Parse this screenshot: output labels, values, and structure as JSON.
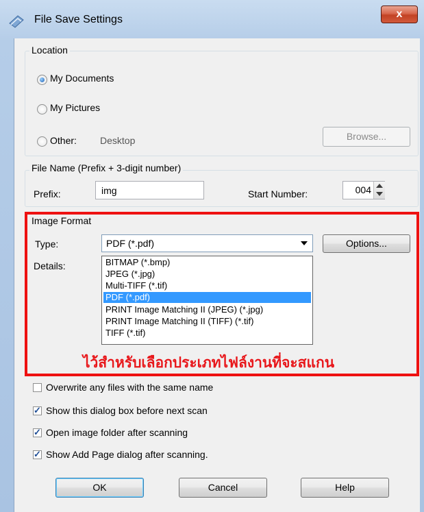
{
  "window": {
    "title": "File Save Settings",
    "close_label": "x"
  },
  "location": {
    "legend": "Location",
    "options": [
      {
        "label": "My Documents",
        "selected": true
      },
      {
        "label": "My Pictures",
        "selected": false
      },
      {
        "label": "Other:",
        "selected": false
      }
    ],
    "other_value": "Desktop",
    "browse_label": "Browse..."
  },
  "filename": {
    "legend": "File Name (Prefix + 3-digit number)",
    "prefix_label": "Prefix:",
    "prefix_value": "img",
    "start_label": "Start Number:",
    "start_value": "004"
  },
  "image_format": {
    "legend": "Image Format",
    "type_label": "Type:",
    "type_value": "PDF (*.pdf)",
    "options_label": "Options...",
    "details_label": "Details:",
    "dropdown_options": [
      "BITMAP (*.bmp)",
      "JPEG (*.jpg)",
      "Multi-TIFF (*.tif)",
      "PDF (*.pdf)",
      "PRINT Image Matching II (JPEG) (*.jpg)",
      "PRINT Image Matching II (TIFF) (*.tif)",
      "TIFF (*.tif)"
    ],
    "selected_index": 3
  },
  "annotation": {
    "text": "ไว้สำหรับเลือกประเภทไฟล์งานที่จะสแกน",
    "color": "#e8171b"
  },
  "checkboxes": [
    {
      "label": "Overwrite any files with the same name",
      "checked": false
    },
    {
      "label": "Show this dialog box before next scan",
      "checked": true
    },
    {
      "label": "Open image folder after scanning",
      "checked": true
    },
    {
      "label": "Show Add Page dialog after scanning.",
      "checked": true
    }
  ],
  "buttons": {
    "ok": "OK",
    "cancel": "Cancel",
    "help": "Help"
  }
}
